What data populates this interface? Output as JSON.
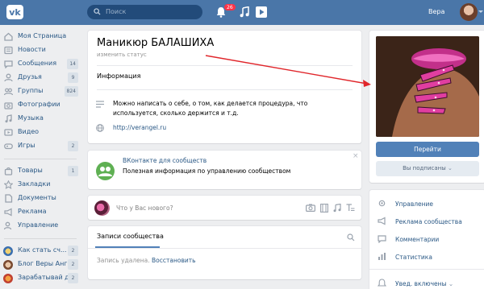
{
  "header": {
    "search_placeholder": "Поиск",
    "notifications_count": "26",
    "username": "Вера"
  },
  "sidebar": {
    "items": [
      {
        "label": "Моя Страница",
        "count": ""
      },
      {
        "label": "Новости",
        "count": ""
      },
      {
        "label": "Сообщения",
        "count": "14"
      },
      {
        "label": "Друзья",
        "count": "9"
      },
      {
        "label": "Группы",
        "count": "824"
      },
      {
        "label": "Фотографии",
        "count": ""
      },
      {
        "label": "Музыка",
        "count": ""
      },
      {
        "label": "Видео",
        "count": ""
      },
      {
        "label": "Игры",
        "count": "2"
      }
    ],
    "items2": [
      {
        "label": "Товары",
        "count": "1"
      },
      {
        "label": "Закладки",
        "count": ""
      },
      {
        "label": "Документы",
        "count": ""
      },
      {
        "label": "Реклама",
        "count": ""
      },
      {
        "label": "Управление",
        "count": ""
      }
    ],
    "items3": [
      {
        "label": "Как стать сч...",
        "count": "2"
      },
      {
        "label": "Блог Веры Анге...",
        "count": "2"
      },
      {
        "label": "Зарабатывай д...",
        "count": "2"
      }
    ]
  },
  "profile": {
    "name": "Маникюр БАЛАШИХА",
    "status": "изменить статус",
    "info_title": "Информация",
    "description": "Можно написать о себе, о том, как делается процедура, что используется, сколько держится и т.д.",
    "website": "http://verangel.ru"
  },
  "promo": {
    "title": "ВКонтакте для сообществ",
    "text": "Полезная информация по управлению сообществом",
    "close": "×"
  },
  "composer": {
    "placeholder": "Что у Вас нового?"
  },
  "posts": {
    "tab": "Записи сообщества",
    "deleted": "Запись удалена.",
    "restore": "Восстановить"
  },
  "right": {
    "go_button": "Перейти",
    "subscribed_button": "Вы подписаны",
    "menu": [
      {
        "label": "Управление"
      },
      {
        "label": "Реклама сообщества"
      },
      {
        "label": "Комментарии"
      },
      {
        "label": "Статистика"
      }
    ],
    "notify": "Увед. включены"
  },
  "colors": {
    "header": "#4a76a8",
    "link": "#2a5885",
    "button": "#5181b8",
    "arrow": "#e0262b"
  }
}
